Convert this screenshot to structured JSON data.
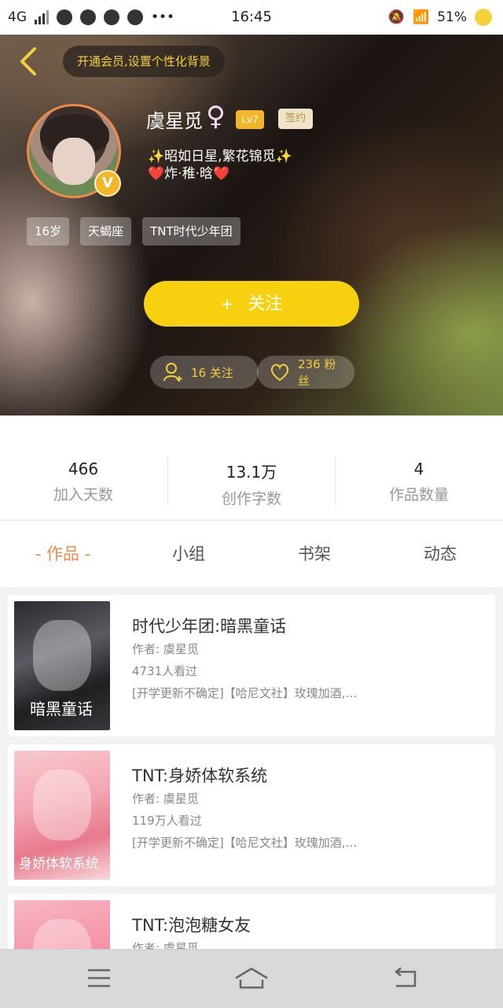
{
  "status_bar": {
    "network": "4G",
    "time": "16:45",
    "battery": "51%"
  },
  "header": {
    "vip_banner": "开通会员,设置个性化背景",
    "username": "虞星觅",
    "gender_symbol": "♀",
    "level": "Lv7",
    "sign_badge": "签约",
    "bio_line1": "✨昭如日星,繁花锦觅✨",
    "bio_line2": "❤️炸·稚·晗❤️",
    "verified_badge": "V",
    "tags": [
      "16岁",
      "天蝎座",
      "TNT时代少年团"
    ],
    "follow_button": "关注",
    "follow_plus": "+",
    "following_pill": "16 关注",
    "fans_pill": "236 粉丝"
  },
  "stats": [
    {
      "value": "466",
      "label": "加入天数"
    },
    {
      "value": "13.1万",
      "label": "创作字数"
    },
    {
      "value": "4",
      "label": "作品数量"
    }
  ],
  "tabs": [
    "- 作品 -",
    "小组",
    "书架",
    "动态"
  ],
  "works": [
    {
      "title": "时代少年团:暗黑童话",
      "author": "作者: 虞星觅",
      "views": "4731人看过",
      "desc": "[开学更新不确定]【哈尼文社】玫瑰加酒,…",
      "cover_text": "暗黑童话"
    },
    {
      "title": "TNT:身娇体软系统",
      "author": "作者: 虞星觅",
      "views": "119万人看过",
      "desc": "[开学更新不确定]【哈尼文社】玫瑰加酒,…",
      "cover_text": "身娇体软系统"
    },
    {
      "title": "TNT:泡泡糖女友",
      "author": "作者: 虞星觅",
      "views": "",
      "desc": "",
      "cover_text": ""
    }
  ],
  "colors": {
    "accent_yellow": "#f7d10f",
    "accent_orange": "#f08a4b",
    "gold_text": "#f4cf3a"
  }
}
